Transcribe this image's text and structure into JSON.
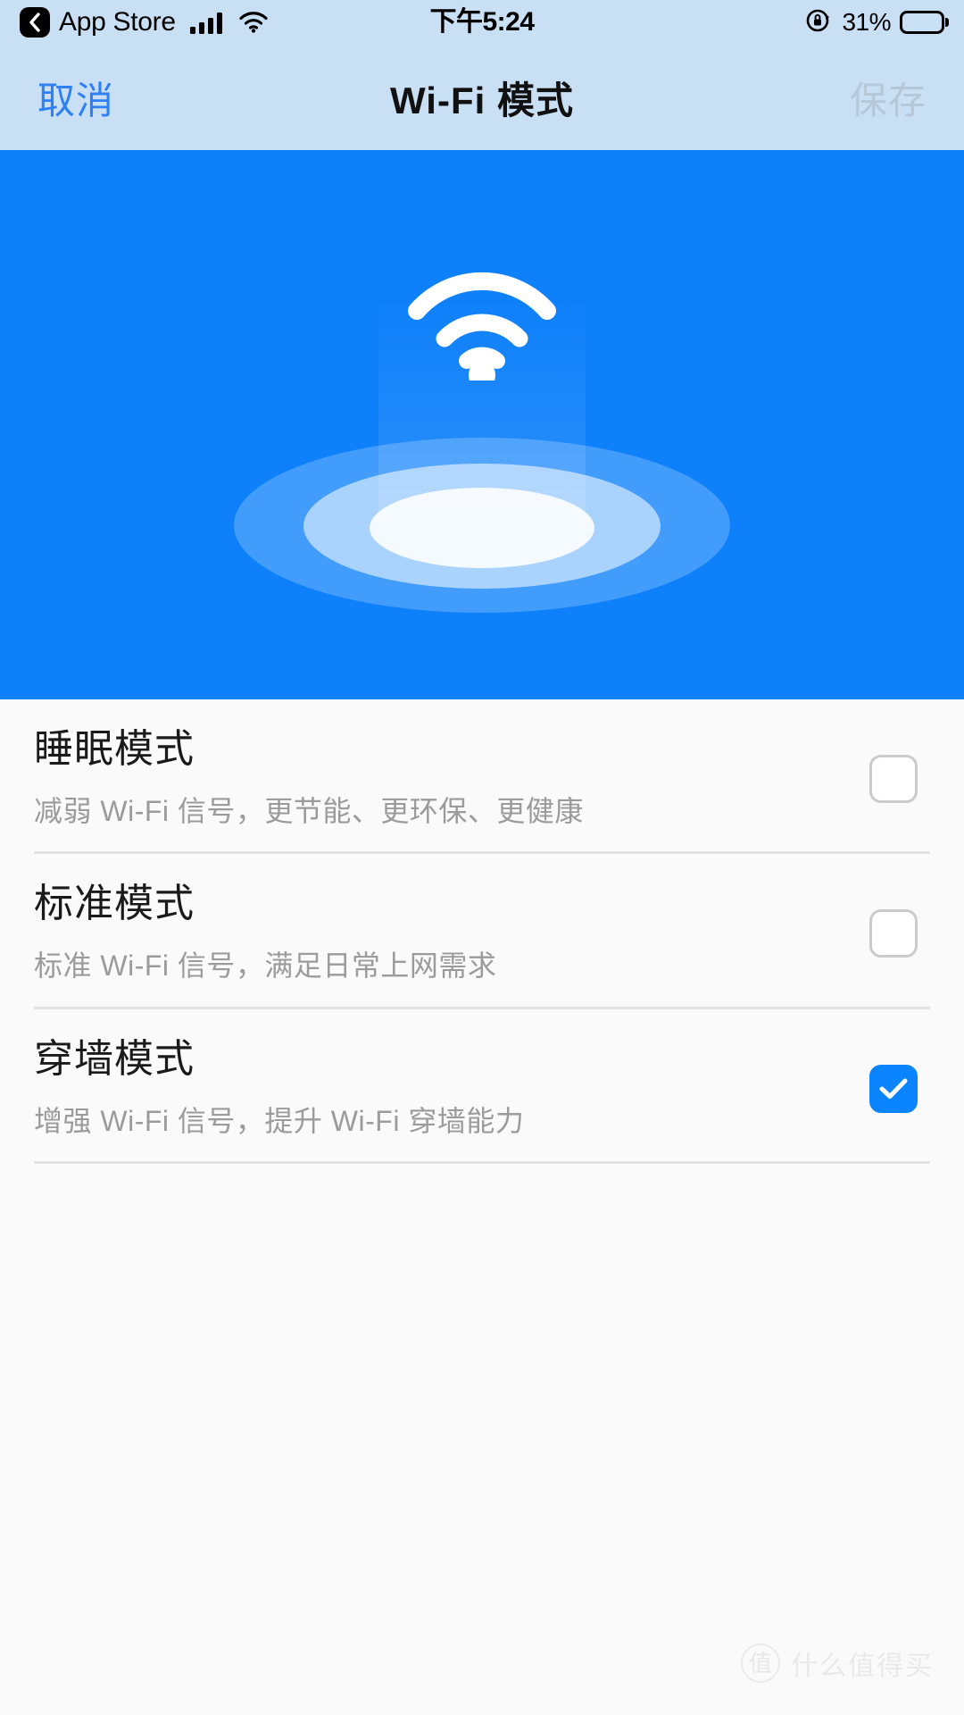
{
  "status_bar": {
    "back_label": "App Store",
    "back_icon": "chevron-left-icon",
    "signal_icon": "cellular-signal-icon",
    "wifi_icon": "wifi-icon",
    "time": "下午5:24",
    "rotation_lock_icon": "rotation-lock-icon",
    "battery_percent": "31%",
    "battery_level": 31,
    "battery_icon": "battery-icon"
  },
  "nav_bar": {
    "cancel_label": "取消",
    "title": "Wi-Fi 模式",
    "save_label": "保存",
    "cancel_color": "#2F80F4",
    "save_color": "#B6C7D8",
    "background": "#C9DFF4"
  },
  "hero": {
    "icon": "wifi-signal-illustration",
    "background": "#0E80FA"
  },
  "options": [
    {
      "title": "睡眠模式",
      "subtitle": "减弱 Wi-Fi 信号，更节能、更环保、更健康",
      "checked": false,
      "checkbox_icon": "checkbox-unchecked-icon"
    },
    {
      "title": "标准模式",
      "subtitle": "标准 Wi-Fi 信号，满足日常上网需求",
      "checked": false,
      "checkbox_icon": "checkbox-unchecked-icon"
    },
    {
      "title": "穿墙模式",
      "subtitle": "增强 Wi-Fi 信号，提升 Wi-Fi 穿墙能力",
      "checked": true,
      "checkbox_icon": "checkbox-checked-icon"
    }
  ],
  "watermark": {
    "logo_text": "值",
    "text": "什么值得买"
  },
  "colors": {
    "accent": "#0A84FF",
    "hero_blue": "#0E80FA",
    "nav_blue": "#C9DFF4",
    "page_background": "#FAFAFA",
    "divider": "#E2E2E2",
    "title_text": "#1A1A1A",
    "subtitle_text": "#9B9B9B"
  }
}
